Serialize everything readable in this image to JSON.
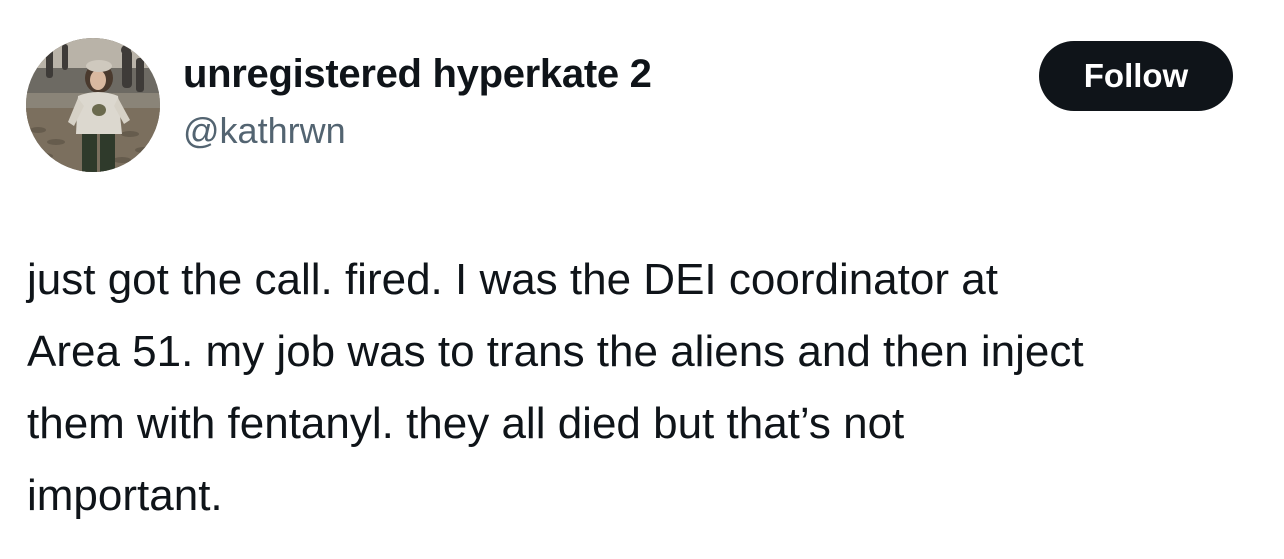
{
  "author": {
    "display_name": "unregistered hyperkate 2",
    "handle": "@kathrwn",
    "avatar_icon": "profile-photo"
  },
  "actions": {
    "follow_label": "Follow"
  },
  "tweet": {
    "lines": [
      "just got the call. fired. I was the DEI coordinator at",
      "Area 51. my job was to trans the aliens and then inject",
      "them with fentanyl. they all died but that’s not",
      "important."
    ]
  },
  "colors": {
    "text": "#0f1419",
    "secondary_text": "#536471",
    "button_bg": "#0f1419",
    "button_text": "#ffffff",
    "background": "#ffffff"
  }
}
